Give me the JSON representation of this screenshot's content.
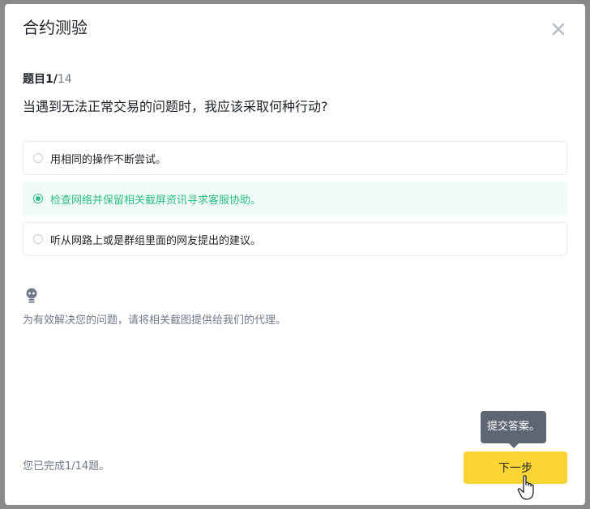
{
  "modal": {
    "title": "合约测验",
    "close_icon": "close-icon"
  },
  "question": {
    "counter_current": "题目1/",
    "counter_total": "14",
    "text": "当遇到无法正常交易的问题时，我应该采取何种行动?"
  },
  "options": [
    {
      "label": "用相同的操作不断尝试。",
      "selected": false
    },
    {
      "label": "检查网络并保留相关截屏资讯寻求客服协助。",
      "selected": true
    },
    {
      "label": "听从网路上或是群组里面的网友提出的建议。",
      "selected": false
    }
  ],
  "hint": {
    "icon": "lightbulb-icon",
    "text": "为有效解决您的问题，请将相关截图提供给我们的代理。"
  },
  "footer": {
    "progress_text": "您已完成1/14题。",
    "tooltip": "提交答案。",
    "next_label": "下一步"
  },
  "colors": {
    "accent_green": "#2ebd85",
    "button_yellow": "#fcd535",
    "tooltip_bg": "#5e6673"
  }
}
